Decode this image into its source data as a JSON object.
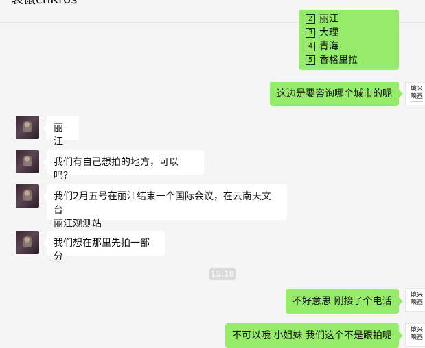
{
  "header": {
    "title": "袋鼠cnKros"
  },
  "messages": {
    "top_list": [
      "丽江",
      "大理",
      "青海",
      "香格里拉"
    ],
    "top_list_numbers": [
      "2",
      "3",
      "4",
      "5"
    ],
    "r1": "这边是要咨询哪个城市的呢",
    "l1": "丽江",
    "l2": "我们有自己想拍的地方，可以吗？",
    "l3_line1": "我们2月五号在丽江结束一个国际会议，在云南天文台",
    "l3_line2": "丽江观测站",
    "l4": "我们想在那里先拍一部分",
    "time": "15:18",
    "r2": "不好意思 刚接了个电话",
    "r3": "不可以哦 小姐妹 我们这个不是跟拍呢"
  },
  "avatar_right": {
    "line1": "境米",
    "line2": "映画"
  }
}
